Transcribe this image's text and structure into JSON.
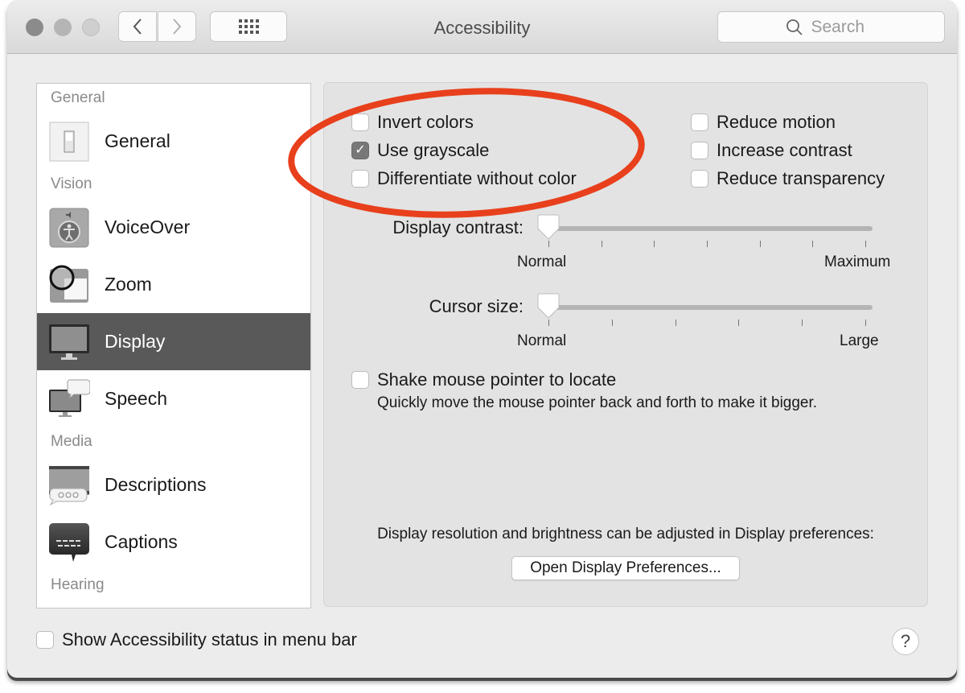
{
  "window": {
    "title": "Accessibility",
    "search_placeholder": "Search",
    "nav": {
      "back_icon": "chevron-left-icon",
      "forward_icon": "chevron-right-icon",
      "grid_icon": "show-all-grid-icon"
    }
  },
  "sidebar": {
    "sections": [
      {
        "header": "General",
        "items": [
          {
            "label": "General",
            "icon": "switch-icon",
            "selected": false
          }
        ]
      },
      {
        "header": "Vision",
        "items": [
          {
            "label": "VoiceOver",
            "icon": "voiceover-icon",
            "selected": false
          },
          {
            "label": "Zoom",
            "icon": "zoom-magnifier-icon",
            "selected": false
          },
          {
            "label": "Display",
            "icon": "display-monitor-icon",
            "selected": true
          },
          {
            "label": "Speech",
            "icon": "speech-bubble-monitor-icon",
            "selected": false
          }
        ]
      },
      {
        "header": "Media",
        "items": [
          {
            "label": "Descriptions",
            "icon": "descriptions-icon",
            "selected": false
          },
          {
            "label": "Captions",
            "icon": "captions-icon",
            "selected": false
          }
        ]
      },
      {
        "header": "Hearing",
        "items": []
      }
    ]
  },
  "display": {
    "left_options": [
      {
        "label": "Invert colors",
        "checked": false
      },
      {
        "label": "Use grayscale",
        "checked": true
      },
      {
        "label": "Differentiate without color",
        "checked": false
      }
    ],
    "right_options": [
      {
        "label": "Reduce motion",
        "checked": false
      },
      {
        "label": "Increase contrast",
        "checked": false
      },
      {
        "label": "Reduce transparency",
        "checked": false
      }
    ],
    "display_contrast": {
      "label": "Display contrast:",
      "min_label": "Normal",
      "max_label": "Maximum",
      "value": 0,
      "ticks": 7
    },
    "cursor_size": {
      "label": "Cursor size:",
      "min_label": "Normal",
      "max_label": "Large",
      "value": 0,
      "ticks": 6
    },
    "shake": {
      "label": "Shake mouse pointer to locate",
      "checked": false,
      "description": "Quickly move the mouse pointer back and forth to make it bigger."
    },
    "resolution_note": "Display resolution and brightness can be adjusted in Display preferences:",
    "open_prefs_button": "Open Display Preferences..."
  },
  "footer": {
    "show_status_label": "Show Accessibility status in menu bar",
    "show_status_checked": false,
    "help_label": "?"
  },
  "annotation": {
    "shape": "ellipse",
    "color": "#e8401c",
    "target": "left_options"
  },
  "check_glyph": "✓"
}
